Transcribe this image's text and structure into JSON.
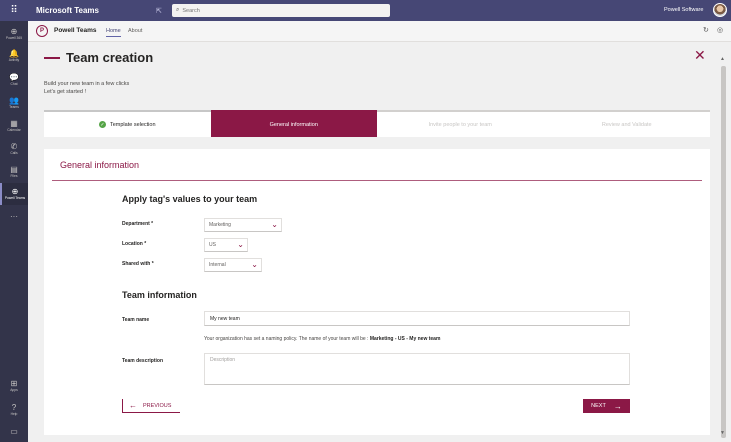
{
  "topbar": {
    "app_title": "Microsoft Teams",
    "search_placeholder": "Search",
    "org_name": "Powell Software"
  },
  "rail": [
    {
      "label": "Powell 365",
      "icon": "⊕"
    },
    {
      "label": "Activity",
      "icon": "🔔"
    },
    {
      "label": "Chat",
      "icon": "💬"
    },
    {
      "label": "Teams",
      "icon": "👥"
    },
    {
      "label": "Calendar",
      "icon": "▦"
    },
    {
      "label": "Calls",
      "icon": "✆"
    },
    {
      "label": "Files",
      "icon": "▤"
    },
    {
      "label": "Powell Teams",
      "icon": "⊕"
    },
    {
      "label": "Apps",
      "icon": "⊞"
    },
    {
      "label": "Help",
      "icon": "?"
    }
  ],
  "app_header": {
    "name": "Powell Teams",
    "tab_home": "Home",
    "tab_about": "About"
  },
  "page": {
    "title": "Team creation",
    "intro_line1": "Build your new team in a few clicks",
    "intro_line2": "Let's get started !"
  },
  "steps": [
    {
      "label": "Template selection",
      "state": "done"
    },
    {
      "label": "General information",
      "state": "active"
    },
    {
      "label": "Invite people to your team",
      "state": "pending"
    },
    {
      "label": "Review and Validate",
      "state": "pending"
    }
  ],
  "form": {
    "panel_title": "General information",
    "tags_heading": "Apply tag's values to your team",
    "department_label": "Department *",
    "department_value": "Marketing",
    "location_label": "Location *",
    "location_value": "US",
    "shared_label": "Shared with *",
    "shared_value": "Internal",
    "teaminfo_heading": "Team information",
    "team_name_label": "Team name",
    "team_name_value": "My new team",
    "naming_policy_text": "Your organization has set a naming policy. The name of your team will be :",
    "naming_policy_value": "Marketing - US - My new team",
    "team_description_label": "Team description",
    "team_description_placeholder": "Description",
    "prev_label": "PREVIOUS",
    "next_label": "NEXT"
  },
  "colors": {
    "brand": "#8b1846",
    "topbar": "#464775",
    "rail": "#33344a",
    "success": "#55a447"
  }
}
